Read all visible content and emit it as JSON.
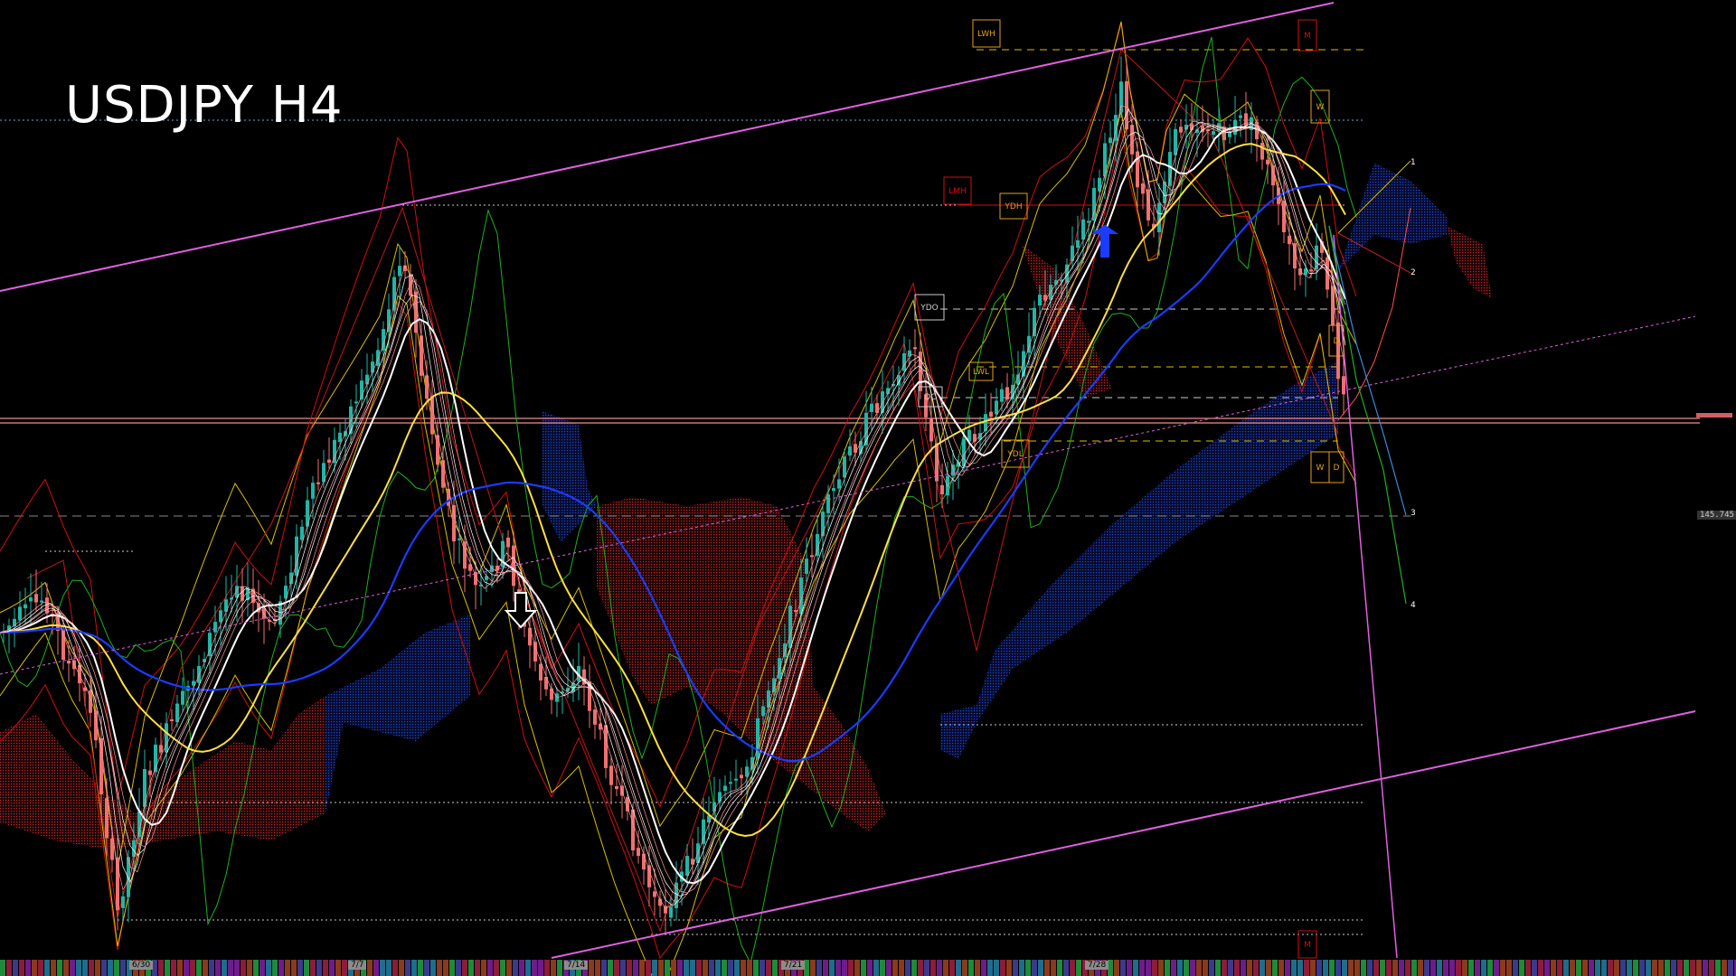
{
  "title": "USDJPY H4",
  "chart_data": {
    "type": "candlestick",
    "symbol": "USDJPY",
    "timeframe": "H4",
    "x_labels": [
      "6/30",
      "7/7",
      "7/14",
      "7/21",
      "7/28"
    ],
    "price_tag": "145.745",
    "fib_labels": [
      "1",
      "2",
      "3",
      "4"
    ],
    "level_boxes": [
      "LWH",
      "LMH",
      "YDH",
      "YDO",
      "DC",
      "LWL",
      "YDL",
      "W",
      "D",
      "W",
      "D",
      "M",
      "M"
    ],
    "annotations": [
      "down-arrow-marker",
      "up-arrow-marker"
    ],
    "colors": {
      "bull": "#1fb6a6",
      "bear": "#f07070",
      "channel": "#e060e0",
      "ma_white": "#ffffff",
      "ma_yellow": "#ffe040",
      "ma_blue": "#1a3cff",
      "kumo_bull": "#1c3aa8",
      "kumo_bear": "#a82a1c",
      "band_red": "#d01010",
      "band_yellow": "#d8c000",
      "band_green": "#20b020",
      "box_orange": "#e0a020"
    }
  }
}
